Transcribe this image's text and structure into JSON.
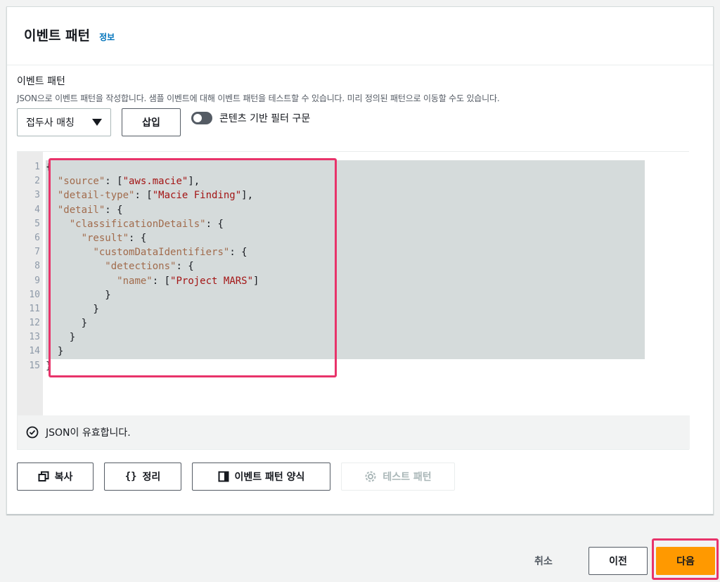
{
  "panel": {
    "title": "이벤트 패턴",
    "info_link": "정보"
  },
  "field": {
    "label": "이벤트 패턴",
    "description": "JSON으로 이벤트 패턴을 작성합니다. 샘플 이벤트에 대해 이벤트 패턴을 테스트할 수 있습니다. 미리 정의된 패턴으로 이동할 수도 있습니다."
  },
  "controls": {
    "dropdown_label": "접두사 매칭",
    "insert_label": "삽입",
    "toggle_label": "콘텐츠 기반 필터 구문",
    "toggle_on": false
  },
  "editor": {
    "line_numbers": [
      "1",
      "2",
      "3",
      "4",
      "5",
      "6",
      "7",
      "8",
      "9",
      "10",
      "11",
      "12",
      "13",
      "14",
      "15"
    ],
    "lines": [
      [
        {
          "t": "p",
          "v": "{"
        }
      ],
      [
        {
          "t": "p",
          "v": "  "
        },
        {
          "t": "k",
          "v": "\"source\""
        },
        {
          "t": "p",
          "v": ": ["
        },
        {
          "t": "s",
          "v": "\"aws.macie\""
        },
        {
          "t": "p",
          "v": "],"
        }
      ],
      [
        {
          "t": "p",
          "v": "  "
        },
        {
          "t": "k",
          "v": "\"detail-type\""
        },
        {
          "t": "p",
          "v": ": ["
        },
        {
          "t": "s",
          "v": "\"Macie Finding\""
        },
        {
          "t": "p",
          "v": "],"
        }
      ],
      [
        {
          "t": "p",
          "v": "  "
        },
        {
          "t": "k",
          "v": "\"detail\""
        },
        {
          "t": "p",
          "v": ": {"
        }
      ],
      [
        {
          "t": "p",
          "v": "    "
        },
        {
          "t": "k",
          "v": "\"classificationDetails\""
        },
        {
          "t": "p",
          "v": ": {"
        }
      ],
      [
        {
          "t": "p",
          "v": "      "
        },
        {
          "t": "k",
          "v": "\"result\""
        },
        {
          "t": "p",
          "v": ": {"
        }
      ],
      [
        {
          "t": "p",
          "v": "        "
        },
        {
          "t": "k",
          "v": "\"customDataIdentifiers\""
        },
        {
          "t": "p",
          "v": ": {"
        }
      ],
      [
        {
          "t": "p",
          "v": "          "
        },
        {
          "t": "k",
          "v": "\"detections\""
        },
        {
          "t": "p",
          "v": ": {"
        }
      ],
      [
        {
          "t": "p",
          "v": "            "
        },
        {
          "t": "k",
          "v": "\"name\""
        },
        {
          "t": "p",
          "v": ": ["
        },
        {
          "t": "s",
          "v": "\"Project MARS\""
        },
        {
          "t": "p",
          "v": "]"
        }
      ],
      [
        {
          "t": "p",
          "v": "          }"
        }
      ],
      [
        {
          "t": "p",
          "v": "        }"
        }
      ],
      [
        {
          "t": "p",
          "v": "      }"
        }
      ],
      [
        {
          "t": "p",
          "v": "    }"
        }
      ],
      [
        {
          "t": "p",
          "v": "  }"
        }
      ],
      [
        {
          "t": "p",
          "v": "}"
        }
      ]
    ],
    "validation_text": "JSON이 유효합니다."
  },
  "actions": {
    "copy": "복사",
    "format": "정리",
    "template": "이벤트 패턴 양식",
    "test": "테스트 패턴"
  },
  "footer": {
    "cancel": "취소",
    "previous": "이전",
    "next": "다음"
  },
  "colors": {
    "accent": "#ff9900",
    "link": "#0073bb",
    "annotation": "#e8336a"
  }
}
